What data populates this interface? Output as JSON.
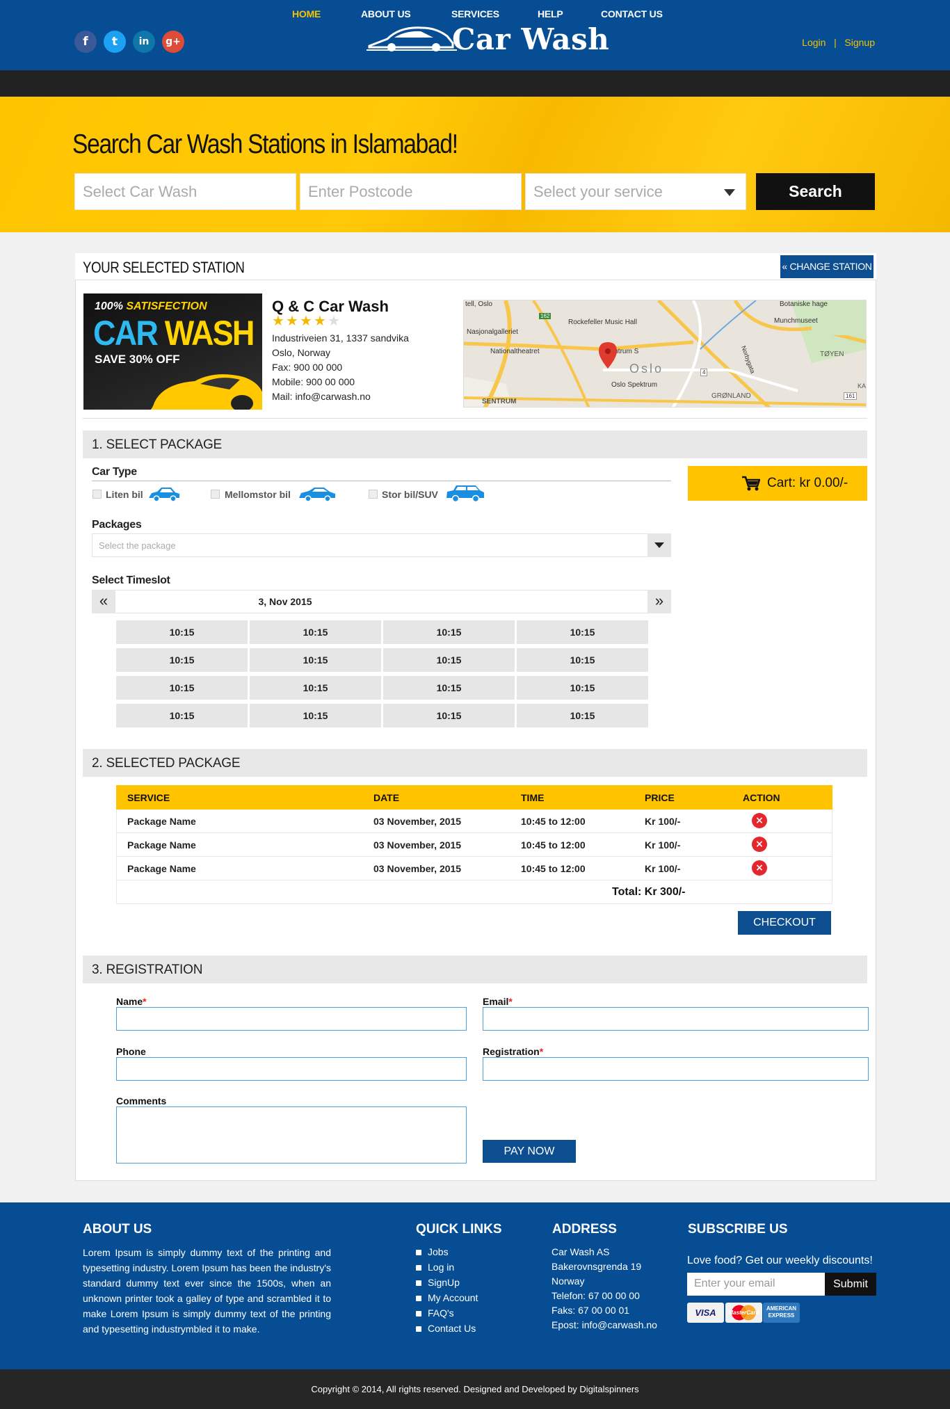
{
  "header": {
    "logo_text": "Car Wash",
    "login": "Login",
    "separator": "|",
    "signup": "Signup",
    "social": [
      {
        "icon": "facebook-icon",
        "glyph": "f",
        "color": "#3b5998"
      },
      {
        "icon": "twitter-icon",
        "glyph": "t",
        "color": "#1da1f2"
      },
      {
        "icon": "linkedin-icon",
        "glyph": "in",
        "color": "#0e76a8"
      },
      {
        "icon": "google-plus-icon",
        "glyph": "g+",
        "color": "#dd4b39"
      }
    ]
  },
  "nav": {
    "items": [
      "HOME",
      "ABOUT US",
      "SERVICES",
      "HELP",
      "CONTACT US"
    ],
    "active": "HOME",
    "active_color": "#f5c300"
  },
  "hero": {
    "title": "Search Car Wash Stations in Islamabad!",
    "car_wash_placeholder": "Select Car Wash",
    "postcode_placeholder": "Enter Postcode",
    "service_placeholder": "Select your service",
    "search_label": "Search"
  },
  "station": {
    "section_title": "YOUR SELECTED STATION",
    "change_label": "CHANGE STATION",
    "promo": {
      "line1a": "100% ",
      "line1b": "SATISFECTION",
      "line2a": "CAR ",
      "line2b": "WASH",
      "line3": "SAVE 30% OFF"
    },
    "name": "Q & C Car Wash",
    "rating": 4,
    "rating_max": 5,
    "address1": "Industriveien 31, 1337 sandvika",
    "address2": "Oslo, Norway",
    "fax": "Fax: 900 00 000",
    "mobile": "Mobile: 900 00 000",
    "mail": "Mail: info@carwash.no",
    "map_labels": [
      "tell, Oslo",
      "Nasjonalgalleriet",
      "Rockefeller Music Hall",
      "Nationaltheatret",
      "Sentrum S",
      "Oslo",
      "Oslo Spektrum",
      "SENTRUM",
      "Botaniske hage",
      "Munchmuseet",
      "TØYEN",
      "GRØNLAND",
      "162",
      "4",
      "161",
      "Norbygata",
      "KA"
    ]
  },
  "package": {
    "section_title": "1. SELECT PACKAGE",
    "car_type_label": "Car Type",
    "car_types": [
      "Liten bil",
      "Mellomstor bil",
      "Stor bil/SUV"
    ],
    "packages_label": "Packages",
    "packages_placeholder": "Select the package",
    "timeslot_label": "Select Timeslot",
    "date": "3, Nov 2015",
    "slots": [
      "10:15",
      "10:15",
      "10:15",
      "10:15",
      "10:15",
      "10:15",
      "10:15",
      "10:15",
      "10:15",
      "10:15",
      "10:15",
      "10:15",
      "10:15",
      "10:15",
      "10:15",
      "10:15"
    ],
    "cart_label": "Cart: kr 0.00/-"
  },
  "selected": {
    "section_title": "2. SELECTED PACKAGE",
    "columns": [
      "SERVICE",
      "DATE",
      "TIME",
      "PRICE",
      "ACTION"
    ],
    "rows": [
      {
        "service": "Package Name",
        "date": "03 November, 2015",
        "time": "10:45 to 12:00",
        "price": "Kr 100/-"
      },
      {
        "service": "Package Name",
        "date": "03 November, 2015",
        "time": "10:45 to 12:00",
        "price": "Kr 100/-"
      },
      {
        "service": "Package Name",
        "date": "03 November, 2015",
        "time": "10:45 to 12:00",
        "price": "Kr 100/-"
      }
    ],
    "total": "Total: Kr 300/-",
    "checkout_label": "CHECKOUT"
  },
  "registration": {
    "section_title": "3. REGISTRATION",
    "name_label": "Name",
    "email_label": "Email",
    "phone_label": "Phone",
    "registration_label": "Registration",
    "comments_label": "Comments",
    "required_mark": "*",
    "pay_label": "PAY NOW"
  },
  "footer": {
    "about_title": "ABOUT US",
    "about_text": "Lorem Ipsum is simply dummy text of the printing and typesetting industry. Lorem Ipsum has been the industry's standard dummy text ever since the 1500s, when an unknown printer took a galley of type and scrambled it to make Lorem Ipsum is simply dummy text of the printing and typesetting industrymbled it to make.",
    "links_title": "QUICK LINKS",
    "links": [
      "Jobs",
      "Log in",
      "SignUp",
      "My Account",
      "FAQ's",
      "Contact Us"
    ],
    "address_title": "ADDRESS",
    "address": [
      "Car Wash AS",
      "Bakerovnsgrenda 19",
      "Norway",
      "Telefon: 67 00 00 00",
      "Faks: 67 00 00 01",
      "Epost: info@carwash.no"
    ],
    "subscribe_title": "SUBSCRIBE US",
    "subscribe_text": "Love food? Get our weekly discounts!",
    "email_placeholder": "Enter your email",
    "submit_label": "Submit",
    "cards": [
      "VISA",
      "MasterCard",
      "AMERICAN EXPRESS"
    ],
    "copyright": "Copyright © 2014, All rights reserved. Designed and Developed by Digitalspinners"
  },
  "colors": {
    "brand_blue": "#074d93",
    "accent_yellow": "#ffc300",
    "dark": "#222222",
    "danger": "#e5262d"
  }
}
